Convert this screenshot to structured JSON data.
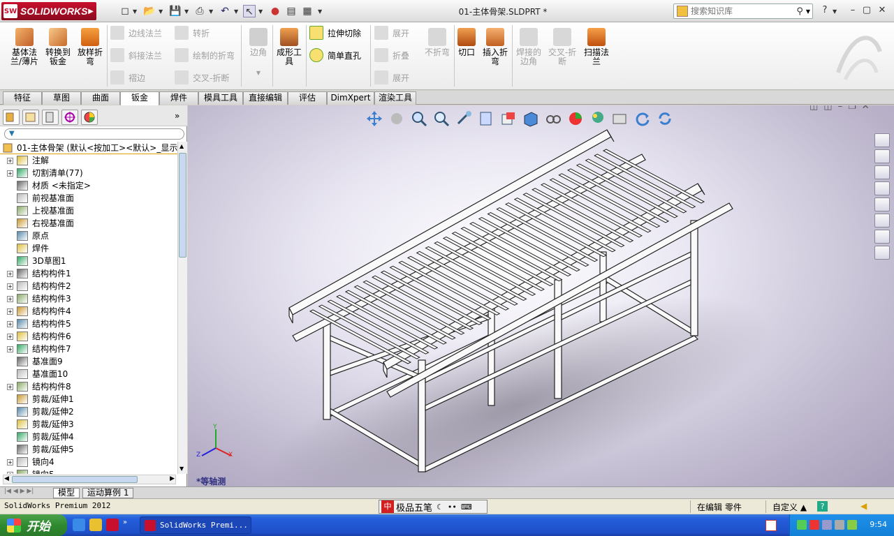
{
  "app": {
    "brand": "SOLIDWORKS",
    "brand_badge": "SW",
    "document_title": "01-主体骨架.SLDPRT *",
    "search_placeholder": "搜索知识库"
  },
  "ribbon": {
    "big_buttons": [
      {
        "label": "基体法\n兰/薄片",
        "enabled": true
      },
      {
        "label": "转换到\n钣金",
        "enabled": true
      },
      {
        "label": "放样折\n弯",
        "enabled": true
      },
      {
        "label": "边角",
        "enabled": false
      },
      {
        "label": "成形工\n具",
        "enabled": true
      },
      {
        "label": "切口",
        "enabled": true
      },
      {
        "label": "插入折\n弯",
        "enabled": true
      },
      {
        "label": "焊接的\n边角",
        "enabled": false
      },
      {
        "label": "交叉-折\n断",
        "enabled": false
      },
      {
        "label": "扫描法\n兰",
        "enabled": true
      }
    ],
    "small_buttons": [
      {
        "label": "边线法兰",
        "enabled": false
      },
      {
        "label": "斜接法兰",
        "enabled": false
      },
      {
        "label": "褶边",
        "enabled": false
      },
      {
        "label": "转折",
        "enabled": false
      },
      {
        "label": "绘制的折弯",
        "enabled": false
      },
      {
        "label": "交叉-折断",
        "enabled": false
      },
      {
        "label": "拉伸切除",
        "enabled": true
      },
      {
        "label": "简单直孔",
        "enabled": true
      },
      {
        "label": "展开",
        "enabled": false
      },
      {
        "label": "折叠",
        "enabled": false
      },
      {
        "label": "展开",
        "enabled": false
      },
      {
        "label": "不折弯",
        "enabled": false
      }
    ]
  },
  "tabs": [
    "特征",
    "草图",
    "曲面",
    "钣金",
    "焊件",
    "模具工具",
    "直接编辑",
    "评估",
    "DimXpert",
    "渲染工具"
  ],
  "active_tab": "钣金",
  "tree": {
    "root": "01-主体骨架  (默认<按加工><默认>_显示",
    "items": [
      {
        "label": "注解",
        "expandable": true
      },
      {
        "label": "切割清单(77)",
        "expandable": true
      },
      {
        "label": "材质 <未指定>",
        "expandable": false
      },
      {
        "label": "前视基准面",
        "expandable": false
      },
      {
        "label": "上视基准面",
        "expandable": false
      },
      {
        "label": "右视基准面",
        "expandable": false
      },
      {
        "label": "原点",
        "expandable": false
      },
      {
        "label": "焊件",
        "expandable": false
      },
      {
        "label": "3D草图1",
        "expandable": false
      },
      {
        "label": "结构构件1",
        "expandable": true
      },
      {
        "label": "结构构件2",
        "expandable": true
      },
      {
        "label": "结构构件3",
        "expandable": true
      },
      {
        "label": "结构构件4",
        "expandable": true
      },
      {
        "label": "结构构件5",
        "expandable": true
      },
      {
        "label": "结构构件6",
        "expandable": true
      },
      {
        "label": "结构构件7",
        "expandable": true
      },
      {
        "label": "基准面9",
        "expandable": false
      },
      {
        "label": "基准面10",
        "expandable": false
      },
      {
        "label": "结构构件8",
        "expandable": true
      },
      {
        "label": "剪裁/延伸1",
        "expandable": false
      },
      {
        "label": "剪裁/延伸2",
        "expandable": false
      },
      {
        "label": "剪裁/延伸3",
        "expandable": false
      },
      {
        "label": "剪裁/延伸4",
        "expandable": false
      },
      {
        "label": "剪裁/延伸5",
        "expandable": false
      },
      {
        "label": "镜向4",
        "expandable": true
      },
      {
        "label": "镜向5",
        "expandable": true
      }
    ]
  },
  "viewport": {
    "view_name": "*等轴测",
    "triad": {
      "x": "X",
      "y": "Y",
      "z": "Z"
    }
  },
  "bottom_tabs": [
    "模型",
    "运动算例 1"
  ],
  "status": {
    "app_version": "SolidWorks Premium 2012",
    "ime_name": "极品五笔",
    "ime_badge": "中",
    "mode": "在编辑 零件",
    "custom": "自定义 ▲",
    "help": "?"
  },
  "taskbar": {
    "start_label": "开始",
    "task_label": "SolidWorks Premi...",
    "clock": "9:54"
  }
}
